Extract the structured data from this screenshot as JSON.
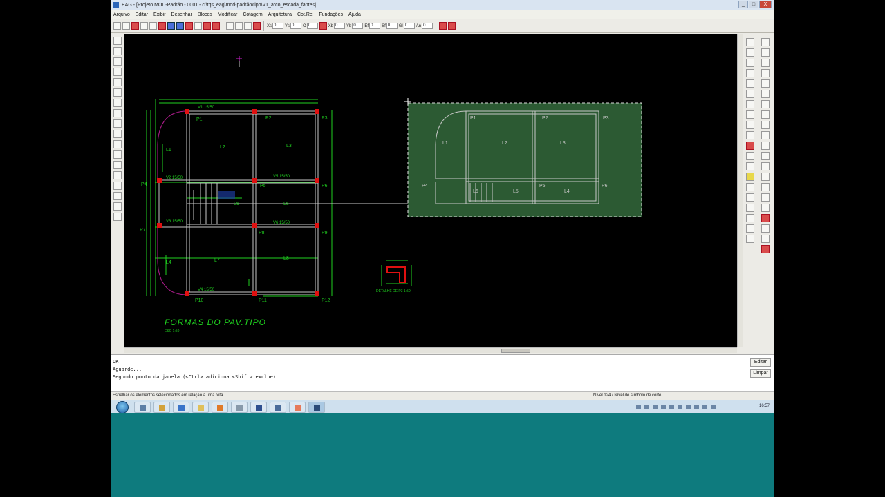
{
  "window": {
    "title": "EAG - [Projeto MOD-Padrão - 0001 - c:\\tqs_eag\\mod-padrão\\tipo\\V1_arco_escada_fantes]",
    "buttons": [
      "_",
      "□",
      "X"
    ]
  },
  "menu": [
    "Arquivo",
    "Editar",
    "Exibir",
    "Desenhar",
    "Blocos",
    "Modificar",
    "Cotagem",
    "Arquitetura",
    "Cot.Rel",
    "Fundações",
    "Ajuda"
  ],
  "toolbar": {
    "fields": [
      {
        "label": "Xs",
        "value": "0"
      },
      {
        "label": "Ys",
        "value": "0"
      },
      {
        "label": "O",
        "value": "0"
      },
      {
        "label": "Xb",
        "value": "0"
      },
      {
        "label": "Yb",
        "value": "0"
      },
      {
        "label": "Ef",
        "value": "0"
      },
      {
        "label": "Sf",
        "value": "0"
      },
      {
        "label": "Gl",
        "value": "0"
      },
      {
        "label": "An",
        "value": "0"
      }
    ]
  },
  "drawing": {
    "title": "FORMAS DO PAV.TIPO",
    "scale_note": "ESC 1:50",
    "detail_note": "DETALHE DE P3 1:50",
    "pillars": [
      "P1",
      "P2",
      "P3",
      "P4",
      "P5",
      "P6",
      "P7",
      "P8",
      "P9",
      "P10",
      "P11",
      "P12"
    ],
    "beams": [
      "V1 15/50",
      "V2 15/50",
      "V3 15/50",
      "V4 15/50",
      "V5 15/50",
      "V6 15/50"
    ],
    "slabs": [
      "L1",
      "L2",
      "L3",
      "L4",
      "L5",
      "L6",
      "L7",
      "L8"
    ],
    "copy_pillars": [
      "P1",
      "P2",
      "P3",
      "P4",
      "P5",
      "P6"
    ],
    "copy_slabs": [
      "L1",
      "L2",
      "L3",
      "L4",
      "L5",
      "L6"
    ]
  },
  "command_lines": [
    "OK",
    "Aguarde...",
    "Segundo ponto da janela (<Ctrl> adiciona <Shift> exclue)"
  ],
  "side_buttons": {
    "edit": "Editar",
    "clear": "Limpar"
  },
  "status": {
    "hint": "Espelhar os elementos selecionados em relação a uma reta",
    "level": "Nível 124 / Nível de símbolo de corte"
  },
  "taskbar": {
    "clock": "16:57"
  },
  "colors": {
    "canvas": "#000000",
    "cad_line": "#c8c8c8",
    "dim_green": "#1fd01f",
    "pillar_red": "#e01010",
    "selection_fill": "#2c5a33",
    "desktop": "#0e7b7e"
  }
}
